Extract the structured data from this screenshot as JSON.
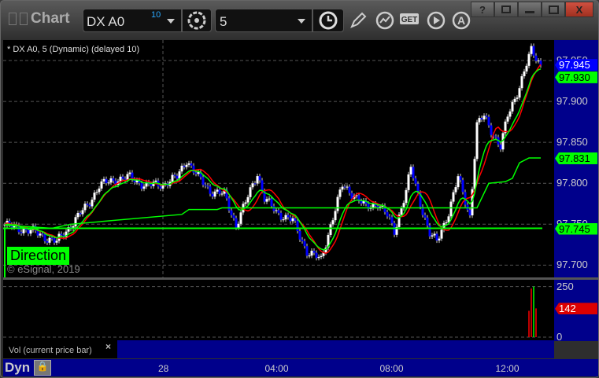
{
  "window": {
    "title": "Chart",
    "symbol": "DX A0",
    "symbol_badge": "10",
    "interval": "5",
    "controls": {
      "help": "?",
      "close": "X"
    }
  },
  "chart": {
    "legend": "* DX A0, 5 (Dynamic) (delayed 10)",
    "direction_label": "Direction",
    "copyright": "© eSignal, 2019",
    "y_ticks": [
      "97.950",
      "97.900",
      "97.850",
      "97.800",
      "97.750",
      "97.700"
    ],
    "tags": [
      {
        "label": "97.945",
        "value": 97.945,
        "color": "#0000ff",
        "text": "#ffffff"
      },
      {
        "label": "97.930",
        "value": 97.93,
        "color": "#00ff00",
        "text": "#000000"
      },
      {
        "label": "97.831",
        "value": 97.831,
        "color": "#00ff00",
        "text": "#000000"
      },
      {
        "label": "97.745",
        "value": 97.745,
        "color": "#00ff00",
        "text": "#000000"
      }
    ],
    "x_ticks": [
      "28",
      "04:00",
      "08:00",
      "12:00"
    ]
  },
  "volume": {
    "label": "Vol (current price bar)",
    "y_ticks": [
      "250",
      "0"
    ],
    "tag": "142",
    "close_icon": "×"
  },
  "footer": {
    "mode": "Dyn"
  },
  "chart_data": {
    "type": "candlestick",
    "ylim": [
      97.685,
      97.975
    ],
    "close_path": [
      [
        0,
        97.749
      ],
      [
        12,
        97.741
      ],
      [
        22,
        97.728
      ],
      [
        28,
        97.749
      ],
      [
        35,
        97.773
      ],
      [
        40,
        97.797
      ],
      [
        47,
        97.805
      ],
      [
        53,
        97.807
      ],
      [
        60,
        97.797
      ],
      [
        67,
        97.799
      ],
      [
        73,
        97.807
      ],
      [
        77,
        97.829
      ],
      [
        82,
        97.807
      ],
      [
        87,
        97.791
      ],
      [
        93,
        97.786
      ],
      [
        98,
        97.749
      ],
      [
        102,
        97.776
      ],
      [
        107,
        97.813
      ],
      [
        110,
        97.781
      ],
      [
        115,
        97.765
      ],
      [
        122,
        97.754
      ],
      [
        128,
        97.717
      ],
      [
        134,
        97.706
      ],
      [
        138,
        97.749
      ],
      [
        143,
        97.797
      ],
      [
        148,
        97.786
      ],
      [
        153,
        97.77
      ],
      [
        158,
        97.776
      ],
      [
        162,
        97.76
      ],
      [
        165,
        97.741
      ],
      [
        170,
        97.791
      ],
      [
        172,
        97.818
      ],
      [
        175,
        97.786
      ],
      [
        180,
        97.738
      ],
      [
        183,
        97.728
      ],
      [
        188,
        97.765
      ],
      [
        192,
        97.807
      ],
      [
        197,
        97.76
      ],
      [
        200,
        97.871
      ],
      [
        203,
        97.882
      ],
      [
        207,
        97.86
      ],
      [
        210,
        97.844
      ],
      [
        213,
        97.882
      ],
      [
        218,
        97.919
      ],
      [
        223,
        97.962
      ],
      [
        227,
        97.945
      ]
    ],
    "direction_line": 97.745,
    "stair_line": [
      [
        0,
        97.749
      ],
      [
        20,
        97.745
      ],
      [
        28,
        97.75
      ],
      [
        75,
        97.762
      ],
      [
        78,
        97.768
      ],
      [
        90,
        97.768
      ],
      [
        92,
        97.77
      ],
      [
        200,
        97.77
      ],
      [
        205,
        97.8
      ],
      [
        212,
        97.802
      ],
      [
        215,
        97.806
      ],
      [
        218,
        97.825
      ],
      [
        222,
        97.831
      ],
      [
        227,
        97.831
      ]
    ],
    "volume_bars": [
      {
        "bar": 224,
        "value": 130,
        "color": "#ff0000"
      },
      {
        "bar": 225,
        "value": 240,
        "color": "#ff0000"
      },
      {
        "bar": 226,
        "value": 250,
        "color": "#00ff00"
      },
      {
        "bar": 227,
        "value": 142,
        "color": "#ff0000"
      }
    ],
    "vol_ylim": [
      0,
      260
    ]
  }
}
